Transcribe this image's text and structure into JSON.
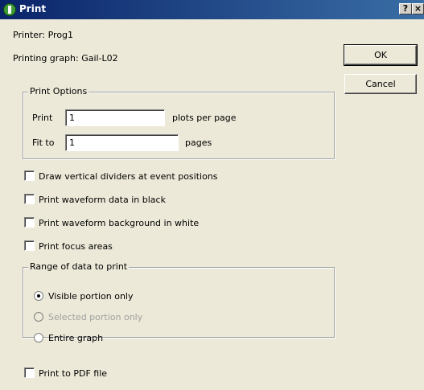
{
  "dialog": {
    "title": "Print",
    "help_button": "?",
    "close_button": "×"
  },
  "info": {
    "printer": "Printer: Prog1",
    "graph": "Printing graph: Gail-L02"
  },
  "buttons": {
    "ok": "OK",
    "cancel": "Cancel"
  },
  "print_options": {
    "legend": "Print Options",
    "print_label": "Print",
    "print_value": "1",
    "print_suffix": "plots per page",
    "fit_label": "Fit to",
    "fit_value": "1",
    "fit_suffix": "pages"
  },
  "checkboxes": {
    "vertical_dividers": {
      "label": "Draw vertical dividers at event positions",
      "checked": false
    },
    "waveform_black": {
      "label": "Print waveform data in black",
      "checked": false
    },
    "background_white": {
      "label": "Print waveform background in white",
      "checked": false
    },
    "focus_areas": {
      "label": "Print focus areas",
      "checked": false
    },
    "pdf_file": {
      "label": "Print to PDF file",
      "checked": false
    }
  },
  "range": {
    "legend": "Range of data to print",
    "visible": {
      "label": "Visible portion only",
      "selected": true
    },
    "selected": {
      "label": "Selected portion only",
      "selected": false,
      "disabled": true
    },
    "entire": {
      "label": "Entire graph",
      "selected": false
    }
  }
}
